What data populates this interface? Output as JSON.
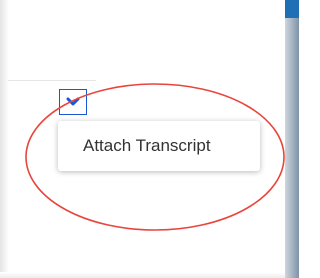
{
  "dropdown": {
    "toggle_icon": "chevron-down-icon",
    "accent_color": "#1a56d6",
    "items": [
      {
        "label": "Attach Transcript"
      }
    ]
  },
  "annotation": {
    "shape": "ellipse",
    "color": "#e8453c"
  }
}
